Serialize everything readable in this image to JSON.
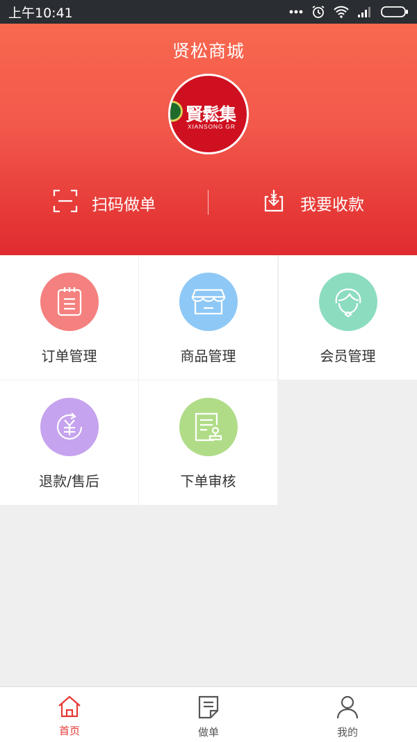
{
  "status_bar": {
    "time": "上午10:41"
  },
  "header": {
    "title": "贤松商城",
    "logo": {
      "text_cn": "賢鬆集",
      "text_en": "XIANSONG GR"
    },
    "actions": [
      {
        "label": "扫码做单",
        "icon": "scan-icon"
      },
      {
        "label": "我要收款",
        "icon": "receive-payment-icon"
      }
    ]
  },
  "grid": {
    "items": [
      {
        "label": "订单管理",
        "icon": "order-list-icon",
        "color": "#f4817f"
      },
      {
        "label": "商品管理",
        "icon": "store-icon",
        "color": "#8ec8f6"
      },
      {
        "label": "会员管理",
        "icon": "member-icon",
        "color": "#8cdcc0"
      },
      {
        "label": "退款/售后",
        "icon": "refund-icon",
        "color": "#c6a3ee"
      },
      {
        "label": "下单审核",
        "icon": "review-icon",
        "color": "#b0dc88"
      }
    ]
  },
  "tabbar": {
    "accent": "#e53935",
    "tabs": [
      {
        "label": "首页",
        "icon": "home-icon",
        "active": true
      },
      {
        "label": "做单",
        "icon": "make-order-icon",
        "active": false
      },
      {
        "label": "我的",
        "icon": "profile-icon",
        "active": false
      }
    ]
  }
}
